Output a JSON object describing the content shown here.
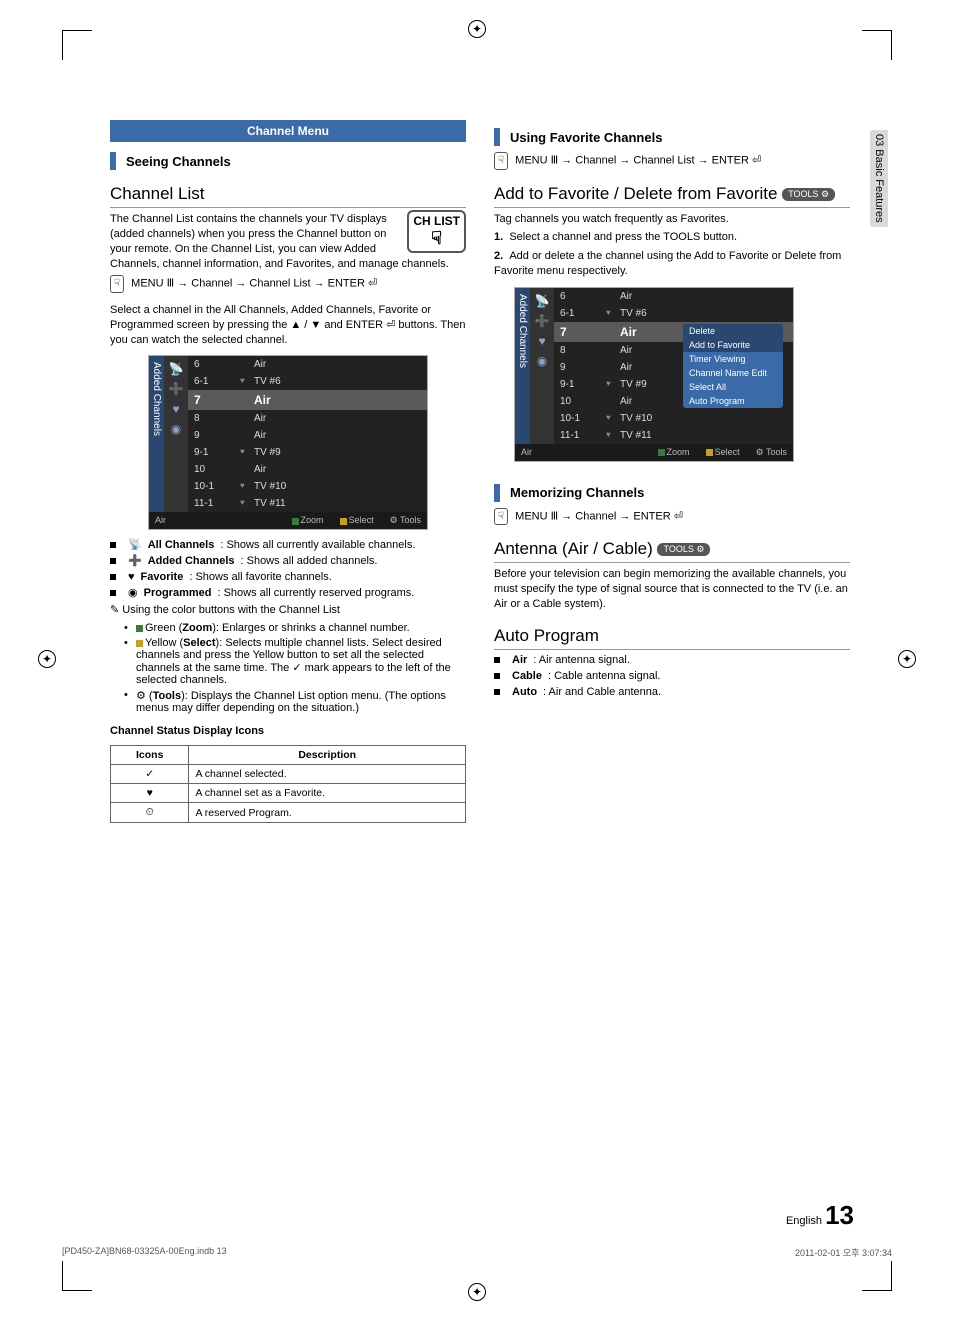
{
  "sideTab": "03  Basic Features",
  "left": {
    "blueHeader": "Channel Menu",
    "sec1Title": "Seeing Channels",
    "h2a": "Channel List",
    "intro": "The Channel List contains the channels your TV displays (added channels) when you press the Channel button on your remote. On the Channel List, you can view Added Channels, channel information, and Favorites, and manage channels.",
    "remoteBtn": "CH LIST",
    "nav1": "MENU Ⅲ → Channel → Channel List → ENTER ⏎",
    "para2a": "Select a channel in the All Channels, Added Channels, Favorite or Programmed screen by pressing the ▲ / ▼ and ENTER ⏎ buttons. Then you can watch the selected channel.",
    "chlist": {
      "side": "Added Channels",
      "rows": [
        {
          "n": "6",
          "heart": "",
          "name": "Air"
        },
        {
          "n": "6-1",
          "heart": "♥",
          "name": "TV #6"
        },
        {
          "n": "7",
          "heart": "",
          "name": "Air",
          "sel": true
        },
        {
          "n": "8",
          "heart": "",
          "name": "Air"
        },
        {
          "n": "9",
          "heart": "",
          "name": "Air"
        },
        {
          "n": "9-1",
          "heart": "♥",
          "name": "TV #9"
        },
        {
          "n": "10",
          "heart": "",
          "name": "Air"
        },
        {
          "n": "10-1",
          "heart": "♥",
          "name": "TV #10"
        },
        {
          "n": "11-1",
          "heart": "♥",
          "name": "TV #11"
        }
      ],
      "foot": {
        "mode": "Air",
        "zoom": "Zoom",
        "select": "Select",
        "tools": "Tools"
      }
    },
    "legend": [
      {
        "icon": "📡",
        "b": "All Channels",
        "t": ": Shows all currently available channels."
      },
      {
        "icon": "➕",
        "b": "Added Channels",
        "t": ": Shows all added channels."
      },
      {
        "icon": "♥",
        "b": "Favorite",
        "t": ": Shows all favorite channels."
      },
      {
        "icon": "◉",
        "b": "Programmed",
        "t": ": Shows all currently reserved programs."
      }
    ],
    "noteLead": "Using the color buttons with the Channel List",
    "notes": [
      {
        "color": "g",
        "b": "Zoom",
        "pre": "Green (",
        "post": "): Enlarges or shrinks a channel number."
      },
      {
        "color": "y",
        "b": "Select",
        "pre": "Yellow (",
        "post": "): Selects multiple channel lists. Select desired channels and press the Yellow button to set all the selected channels at the same time. The ✓ mark appears to the left of the selected channels."
      },
      {
        "color": "",
        "b": "Tools",
        "pre": "⚙ (",
        "post": "): Displays the Channel List option menu. (The options menus may differ depending on the situation.)"
      }
    ],
    "tblTitle": "Channel Status Display Icons",
    "tbl": {
      "h1": "Icons",
      "h2": "Description",
      "rows": [
        {
          "i": "✓",
          "d": "A channel selected."
        },
        {
          "i": "♥",
          "d": "A channel set as a Favorite."
        },
        {
          "i": "⏲",
          "d": "A reserved Program."
        }
      ]
    }
  },
  "right": {
    "sec1Title": "Using Favorite Channels",
    "nav1": "MENU Ⅲ → Channel → Channel List → ENTER ⏎",
    "h2a": "Add to Favorite / Delete from Favorite",
    "tools": "TOOLS ⚙",
    "p1": "Tag channels you watch frequently as Favorites.",
    "step1": "Select a channel and press the TOOLS button.",
    "step2": "Add or delete a the channel using the Add to Favorite or Delete from Favorite menu respectively.",
    "chlist": {
      "side": "Added Channels",
      "rows": [
        {
          "n": "6",
          "heart": "",
          "name": "Air"
        },
        {
          "n": "6-1",
          "heart": "♥",
          "name": "TV #6"
        },
        {
          "n": "7",
          "heart": "",
          "name": "Air",
          "sel": true
        },
        {
          "n": "8",
          "heart": "",
          "name": "Air"
        },
        {
          "n": "9",
          "heart": "",
          "name": "Air"
        },
        {
          "n": "9-1",
          "heart": "♥",
          "name": "TV #9"
        },
        {
          "n": "10",
          "heart": "",
          "name": "Air"
        },
        {
          "n": "10-1",
          "heart": "♥",
          "name": "TV #10"
        },
        {
          "n": "11-1",
          "heart": "♥",
          "name": "TV #11"
        }
      ],
      "foot": {
        "mode": "Air",
        "zoom": "Zoom",
        "select": "Select",
        "tools": "Tools"
      },
      "popup": [
        "Delete",
        "Add to Favorite",
        "Timer Viewing",
        "Channel Name Edit",
        "Select All",
        "Auto Program"
      ]
    },
    "sec2Title": "Memorizing Channels",
    "nav2": "MENU Ⅲ → Channel → ENTER ⏎",
    "h2b": "Antenna (Air / Cable)",
    "p2": "Before your television can begin memorizing the available channels, you must specify the type of signal source that is connected to the TV (i.e. an Air or a Cable system).",
    "h2c": "Auto Program",
    "auto": [
      {
        "b": "Air",
        "t": ": Air antenna signal."
      },
      {
        "b": "Cable",
        "t": ": Cable antenna signal."
      },
      {
        "b": "Auto",
        "t": ": Air and Cable antenna."
      }
    ]
  },
  "pageLang": "English",
  "pageNum": "13",
  "footL": "[PD450-ZA]BN68-03325A-00Eng.indb   13",
  "footR": "2011-02-01   오후 3:07:34"
}
